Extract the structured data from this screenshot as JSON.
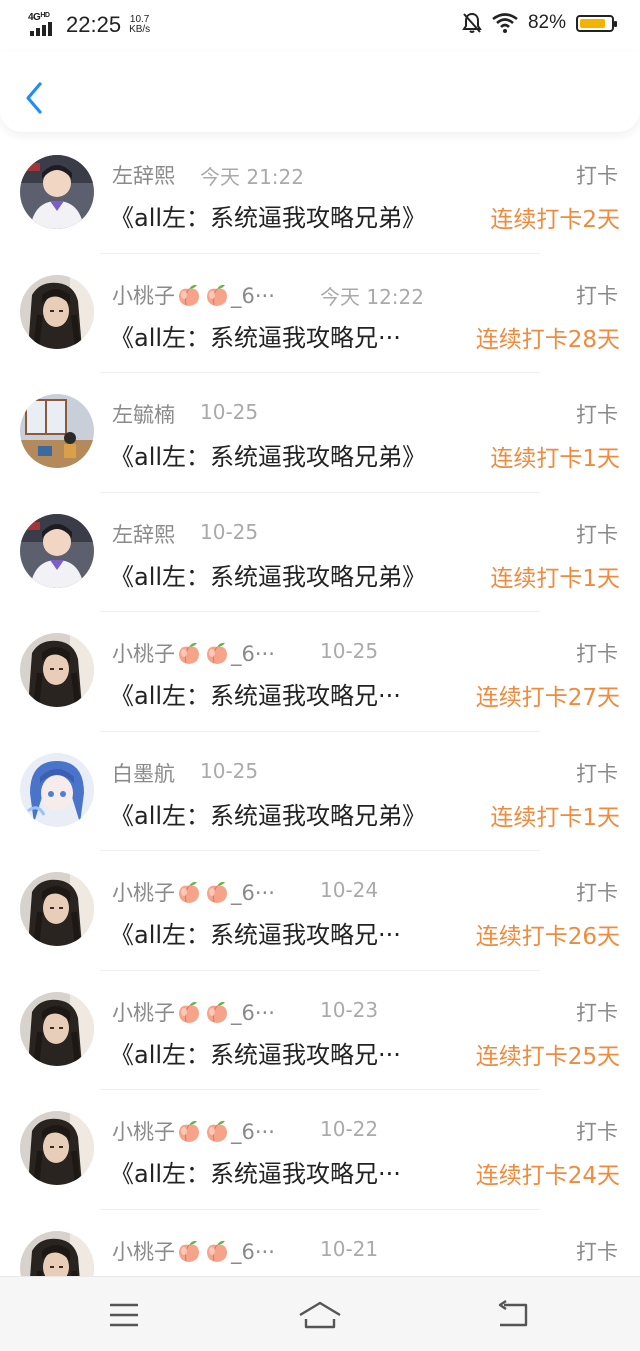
{
  "status": {
    "network": "4G",
    "network_hd": "HD",
    "time": "22:25",
    "speed_value": "10.7",
    "speed_unit": "KB/s",
    "battery_percent": "82%",
    "battery_level": 0.82,
    "colors": {
      "battery": "#f3b400"
    }
  },
  "nav": {
    "back_icon": "chevron-left-icon",
    "accent": "#1e8ffa"
  },
  "entries": [
    {
      "name": "左辞熙",
      "date": "今天 21:22",
      "type": "打卡",
      "book": "《all左：系统逼我攻略兄弟》",
      "streak": "连续打卡2天",
      "peaches": false,
      "avatar": "boy"
    },
    {
      "name": "小桃子",
      "name_suffix": "_6···",
      "date": "今天 12:22",
      "type": "打卡",
      "book": "《all左：系统逼我攻略兄···",
      "streak": "连续打卡28天",
      "peaches": true,
      "avatar": "dark"
    },
    {
      "name": "左毓楠",
      "date": "10-25",
      "type": "打卡",
      "book": "《all左：系统逼我攻略兄弟》",
      "streak": "连续打卡1天",
      "peaches": false,
      "avatar": "room"
    },
    {
      "name": "左辞熙",
      "date": "10-25",
      "type": "打卡",
      "book": "《all左：系统逼我攻略兄弟》",
      "streak": "连续打卡1天",
      "peaches": false,
      "avatar": "boy"
    },
    {
      "name": "小桃子",
      "name_suffix": "_6···",
      "date": "10-25",
      "type": "打卡",
      "book": "《all左：系统逼我攻略兄···",
      "streak": "连续打卡27天",
      "peaches": true,
      "avatar": "dark"
    },
    {
      "name": "白墨航",
      "date": "10-25",
      "type": "打卡",
      "book": "《all左：系统逼我攻略兄弟》",
      "streak": "连续打卡1天",
      "peaches": false,
      "avatar": "anime"
    },
    {
      "name": "小桃子",
      "name_suffix": "_6···",
      "date": "10-24",
      "type": "打卡",
      "book": "《all左：系统逼我攻略兄···",
      "streak": "连续打卡26天",
      "peaches": true,
      "avatar": "dark"
    },
    {
      "name": "小桃子",
      "name_suffix": "_6···",
      "date": "10-23",
      "type": "打卡",
      "book": "《all左：系统逼我攻略兄···",
      "streak": "连续打卡25天",
      "peaches": true,
      "avatar": "dark"
    },
    {
      "name": "小桃子",
      "name_suffix": "_6···",
      "date": "10-22",
      "type": "打卡",
      "book": "《all左：系统逼我攻略兄···",
      "streak": "连续打卡24天",
      "peaches": true,
      "avatar": "dark"
    },
    {
      "name": "小桃子",
      "name_suffix": "_6···",
      "date": "10-21",
      "type": "打卡",
      "book": "",
      "streak": "",
      "peaches": true,
      "avatar": "dark"
    }
  ],
  "bottom_nav": {
    "menu_icon": "menu-icon",
    "home_icon": "home-icon",
    "back_icon": "return-icon"
  },
  "colors": {
    "streak": "#f08a3c",
    "name": "#8a8a8a",
    "date": "#aaaaaa"
  }
}
